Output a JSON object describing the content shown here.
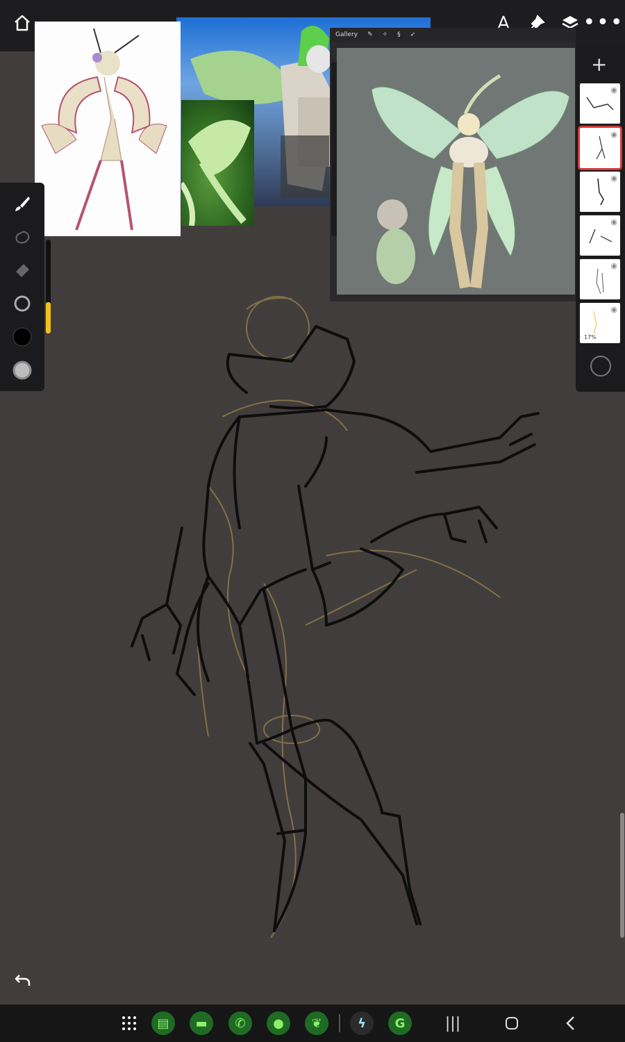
{
  "toolbar": {
    "icons": [
      "home-icon",
      "ruler-compass-icon",
      "pushpin-icon",
      "layers-icon",
      "more-icon"
    ],
    "more_label": "•••"
  },
  "reference_window": {
    "tabs": [
      "Gallery"
    ]
  },
  "layers_panel": {
    "add_label": "+",
    "layers": [
      {
        "visible": true,
        "selected": false
      },
      {
        "visible": true,
        "selected": true
      },
      {
        "visible": true,
        "selected": false
      },
      {
        "visible": true,
        "selected": false
      },
      {
        "visible": true,
        "selected": false
      },
      {
        "visible": true,
        "selected": false,
        "opacity_label": "17%"
      }
    ]
  },
  "sidebar": {
    "tools": [
      "brush-icon",
      "smudge-icon",
      "eraser-icon",
      "brush-size-icon",
      "color-black-swatch",
      "color-grey-swatch"
    ],
    "brush_size_fraction": 0.33
  },
  "navbar": {
    "apps": [
      "apps-grid-icon",
      "notes-app-icon",
      "files-app-icon",
      "phone-app-icon",
      "messages-app-icon",
      "leaf-app-icon",
      "bolt-app-icon",
      "g-app-icon"
    ],
    "system": [
      "recents-icon",
      "home-icon",
      "back-icon"
    ]
  },
  "colors": {
    "canvas": "#413d3d",
    "ui_dark": "#1b1b1d",
    "accent_selection": "#d23a3a",
    "slider_yellow": "#f1c21b"
  }
}
